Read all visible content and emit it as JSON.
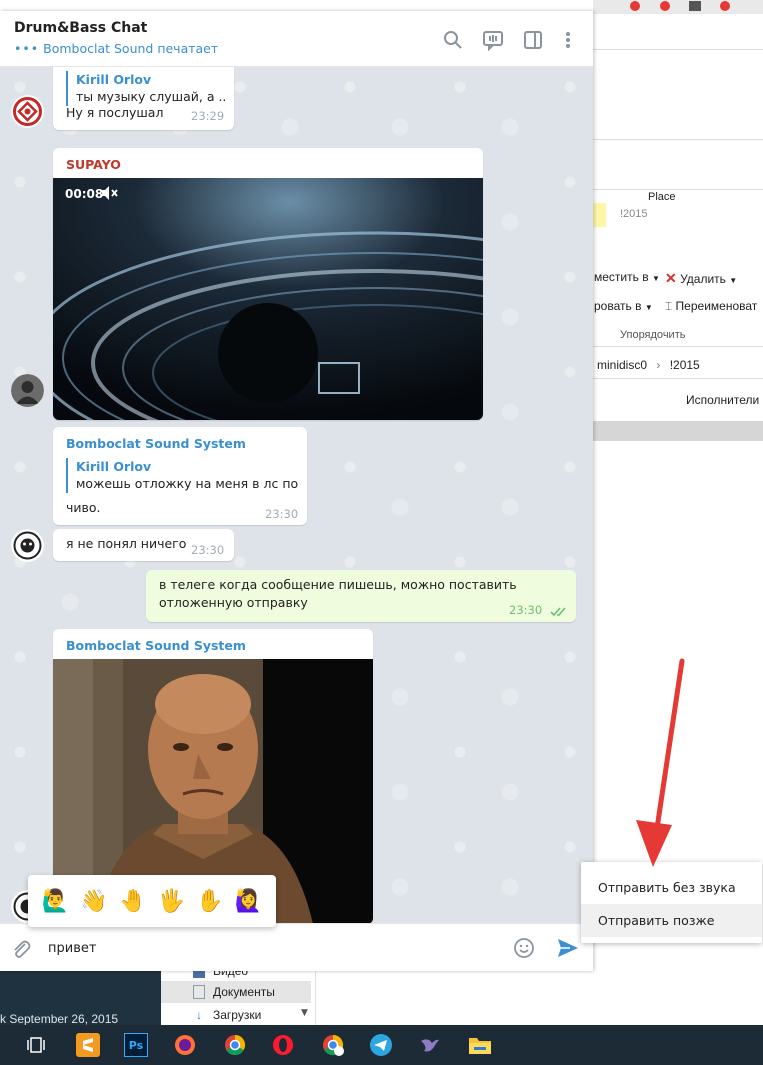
{
  "explorer": {
    "column_place": "Place",
    "folder_year": "!2015",
    "move_to": "местить в",
    "delete": "Удалить",
    "copy_to": "ровать в",
    "rename": "Переименоват",
    "organize": "Упорядочить",
    "path_minidisc": "minidisc0",
    "path_sep": "›",
    "path_year": "!2015",
    "column_artists": "Исполнители",
    "nav_video": "Видео",
    "nav_documents": "Документы",
    "nav_downloads": "Загрузки",
    "date_text": "k September 26, 2015"
  },
  "chat": {
    "title": "Drum&Bass Chat",
    "typing_dots": "•••",
    "status": "Bomboclat Sound печатает"
  },
  "messages": {
    "m1": {
      "reply_name": "Kirill Orlov",
      "reply_text": "ты музыку слушай, а ...",
      "text": "Ну я послушал",
      "time": "23:29"
    },
    "m2": {
      "sender": "SUPAYO",
      "video_duration": "00:08",
      "sender_color": "#c0392b"
    },
    "m3": {
      "sender": "Bomboclat Sound System",
      "reply_name": "Kirill Orlov",
      "reply_text": "можешь отложку на меня в лс по...",
      "text": "чиво.",
      "time": "23:30"
    },
    "m4": {
      "text": "я не понял ничего",
      "time": "23:30"
    },
    "m5": {
      "text_line1": "в телеге когда сообщение пишешь, можно поставить",
      "text_line2": "отложенную отправку",
      "time": "23:30"
    },
    "m6": {
      "sender": "Bomboclat Sound System"
    }
  },
  "emoji_bar": [
    "🙋‍♂️",
    "👋",
    "🤚",
    "🖐",
    "✋",
    "🙋‍♀️"
  ],
  "composer": {
    "value": "привет"
  },
  "send_menu": {
    "item1": "Отправить без звука",
    "item2": "Отправить позже"
  },
  "colors": {
    "accent": "#3a8fd1",
    "out_bubble": "#effdde",
    "arrow": "#e53935"
  }
}
